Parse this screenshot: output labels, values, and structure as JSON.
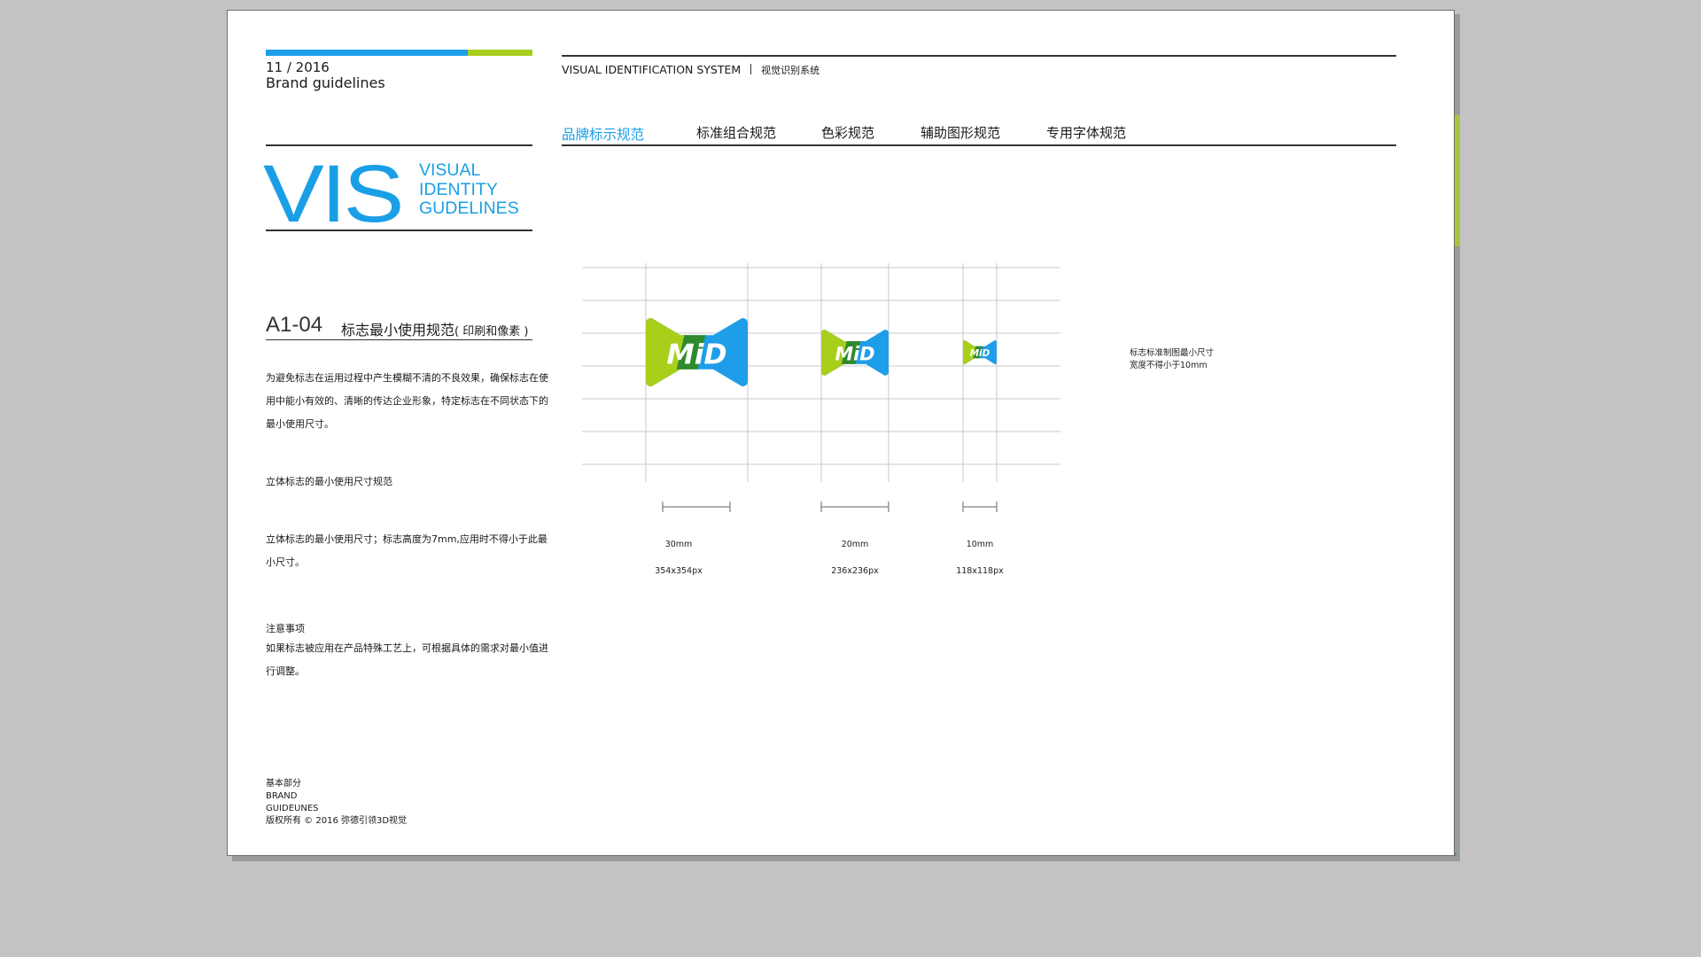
{
  "header": {
    "date": "11 / 2016",
    "brand": "Brand guidelines",
    "system_en": "VISUAL IDENTIFICATION SYSTEM",
    "system_zh": "视觉识别系统"
  },
  "colors": {
    "blue": "#1e9ee8",
    "green": "#a8cf1a",
    "dark_green": "#2f8a2f",
    "line": "#333333"
  },
  "vis": {
    "big": "VIS",
    "line1": "VISUAL",
    "line2": "IDENTITY",
    "line3": "GUDELINES"
  },
  "tabs": [
    {
      "label": "品牌标示规范",
      "active": true
    },
    {
      "label": "标准组合规范",
      "active": false
    },
    {
      "label": "色彩规范",
      "active": false
    },
    {
      "label": "辅助图形规范",
      "active": false
    },
    {
      "label": "专用字体规范",
      "active": false
    }
  ],
  "section": {
    "code": "A1-04",
    "title": "标志最小使用规范",
    "subtitle": "( 印刷和像素 )",
    "para1": "为避免标志在运用过程中产生模糊不清的不良效果，确保标志在使用中能小有效的、清晰的传达企业形象，特定标志在不同状态下的最小使用尺寸。",
    "heading2": "立体标志的最小使用尺寸规范",
    "para2": "立体标志的最小使用尺寸；标志高度为7mm,应用时不得小于此最小尺寸。",
    "heading3": "注意事项",
    "para3": "如果标志被应用在产品特殊工艺上，可根据具体的需求对最小值进行调整。"
  },
  "logo": {
    "text": "MiD"
  },
  "sizes": [
    {
      "mm": "30mm",
      "px": "354x354px"
    },
    {
      "mm": "20mm",
      "px": "236x236px"
    },
    {
      "mm": "10mm",
      "px": "118x118px"
    }
  ],
  "note": {
    "line1": "标志标准制图最小尺寸",
    "line2": "宽度不得小于10mm"
  },
  "footer": {
    "line1": "基本部分",
    "line2": "BRAND",
    "line3": "GUIDEUNES",
    "line4": "版权所有 © 2016  弥德引领3D视觉"
  }
}
